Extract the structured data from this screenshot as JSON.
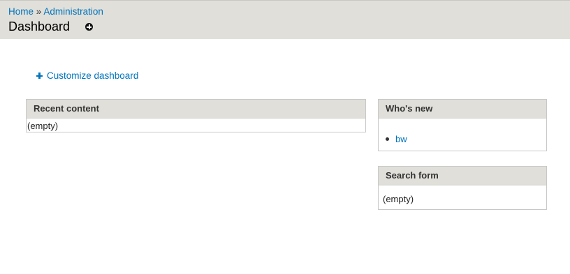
{
  "header": {
    "breadcrumb": {
      "home": "Home",
      "separator": "»",
      "administration": "Administration"
    },
    "title": "Dashboard",
    "shortcut_icon": "add-shortcut-icon"
  },
  "customize": {
    "icon": "plus-icon",
    "label": "Customize dashboard"
  },
  "blocks": {
    "recent_content": {
      "title": "Recent content",
      "body": "(empty)"
    },
    "whos_new": {
      "title": "Who's new",
      "users": [
        "bw"
      ]
    },
    "search_form": {
      "title": "Search form",
      "body": "(empty)"
    }
  },
  "colors": {
    "header_bg": "#e0dfd9",
    "link": "#0074bd",
    "block_border": "#c8c8c8"
  }
}
